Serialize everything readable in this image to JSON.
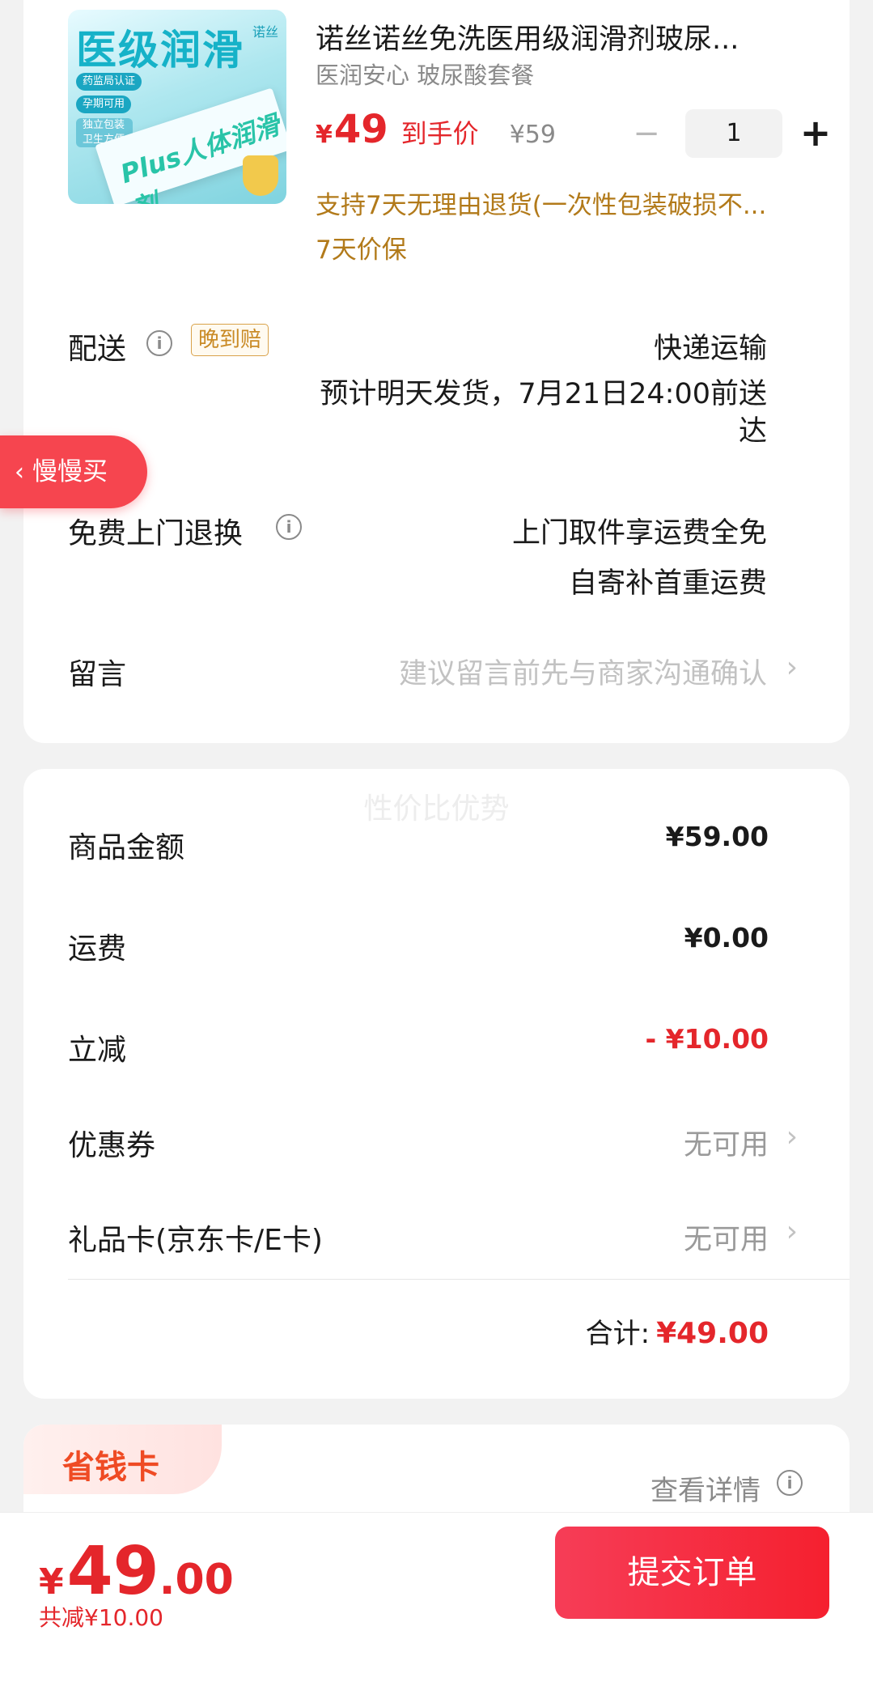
{
  "product": {
    "image_text": {
      "title": "医级润滑",
      "brand": "诺丝",
      "tag1": "药监局认证",
      "tag2": "孕期可用",
      "tag3": "独立包装 卫生方便",
      "box": "Plus人体润滑剂"
    },
    "title": "诺丝诺丝免洗医用级润滑剂玻尿...",
    "spec": "医润安心 玻尿酸套餐",
    "price_symbol": "¥",
    "price": "49",
    "price_label": "到手价",
    "original_price": "¥59",
    "quantity": "1",
    "minus_glyph": "−",
    "plus_glyph": "+",
    "return_note": "支持7天无理由退货(一次性包装破损不...",
    "price_protect": "7天价保"
  },
  "delivery": {
    "label": "配送",
    "badge": "晚到赔",
    "method": "快递运输",
    "estimate_line1": "预计明天发货，7月21日24:00前送",
    "estimate_line2": "达"
  },
  "return_service": {
    "label": "免费上门退换",
    "line1": "上门取件享运费全免",
    "line2": "自寄补首重运费"
  },
  "message": {
    "label": "留言",
    "placeholder": "建议留言前先与商家沟通确认",
    "chevron": "›"
  },
  "slow_buy": {
    "arrow": "‹",
    "label": "慢慢买"
  },
  "pricing": {
    "watermark": "性价比优势",
    "goods_label": "商品金额",
    "goods_value": "¥59.00",
    "shipping_label": "运费",
    "shipping_value": "¥0.00",
    "discount_label": "立减",
    "discount_value": "- ¥10.00",
    "coupon_label": "优惠券",
    "coupon_value": "无可用",
    "giftcard_label": "礼品卡(京东卡/E卡)",
    "giftcard_value": "无可用",
    "chevron": "›",
    "total_label": "合计:",
    "total_value": "¥49.00"
  },
  "saving_card": {
    "title": "省钱卡",
    "detail": "查看详情"
  },
  "bottom_bar": {
    "price_symbol": "¥",
    "price_int": "49",
    "price_dec": ".00",
    "saved": "共减¥10.00",
    "submit": "提交订单"
  },
  "icons": {
    "info": "i"
  },
  "colors": {
    "accent_red": "#e4262b",
    "note_gold": "#b27a1a",
    "slow_buy_bg": "#f6454f",
    "saving_orange": "#ef4b24"
  }
}
